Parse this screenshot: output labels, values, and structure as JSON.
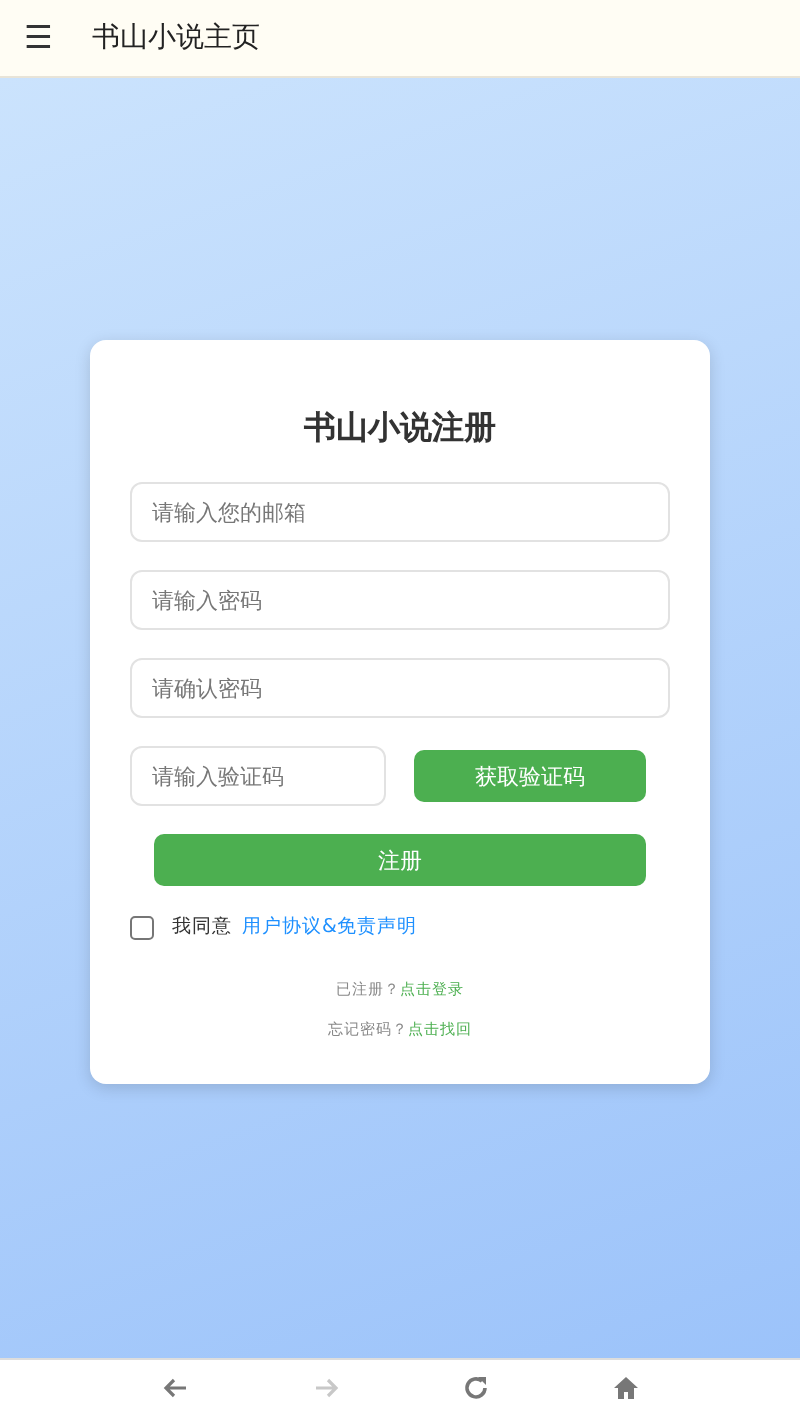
{
  "app_bar": {
    "menu_icon": "☰",
    "title": "书山小说主页"
  },
  "form": {
    "title": "书山小说注册",
    "fields": [
      {
        "placeholder": "请输入您的邮箱"
      },
      {
        "placeholder": "请输入密码"
      },
      {
        "placeholder": "请确认密码"
      }
    ],
    "code_field": {
      "placeholder": "请输入验证码"
    },
    "code_button": "获取验证码",
    "submit_button": "注册",
    "agree": {
      "checked": false,
      "label": "我同意",
      "link": "用户协议&免责声明"
    },
    "links": [
      {
        "text": "已注册？",
        "link": "点击登录"
      },
      {
        "text": "忘记密码？",
        "link": "点击找回"
      }
    ]
  },
  "nav": [
    {
      "kind": "back",
      "disabled": false
    },
    {
      "kind": "forward",
      "disabled": true
    },
    {
      "kind": "reload",
      "disabled": false
    },
    {
      "kind": "home",
      "disabled": false
    }
  ]
}
